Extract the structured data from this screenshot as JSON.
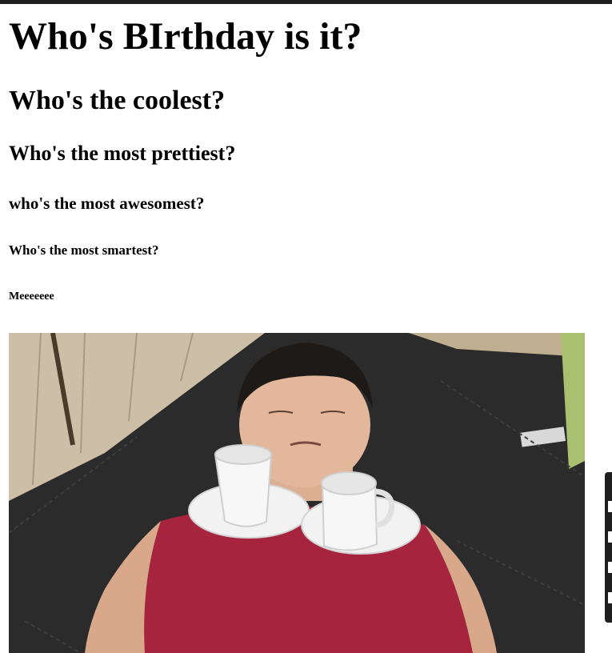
{
  "headings": {
    "h1": "Who's BIrthday is it?",
    "h2": "Who's the coolest?",
    "h3": "Who's the most prettiest?",
    "h4": "who's the most awesomest?",
    "h5": "Who's the most smartest?",
    "h6": "Meeeeeee"
  },
  "colors": {
    "top_bar": "#1e1e1e",
    "text": "#000000",
    "background": "#ffffff",
    "side_widget": "#1f1f1f"
  }
}
